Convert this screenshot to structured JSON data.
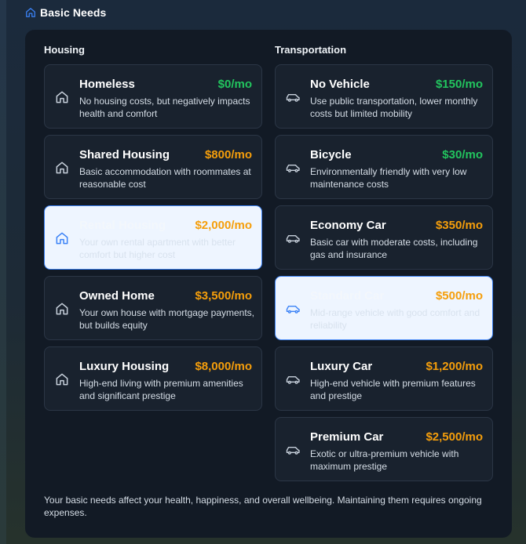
{
  "header": {
    "title": "Basic Needs",
    "icon": "home-icon"
  },
  "housing": {
    "heading": "Housing",
    "options": [
      {
        "title": "Homeless",
        "price": "$0/mo",
        "description": "No housing costs, but negatively impacts health and comfort",
        "price_color": "green",
        "selected": false,
        "icon": "home-icon"
      },
      {
        "title": "Shared Housing",
        "price": "$800/mo",
        "description": "Basic accommodation with roommates at reasonable cost",
        "price_color": "orange",
        "selected": false,
        "icon": "home-icon"
      },
      {
        "title": "Rental Housing",
        "price": "$2,000/mo",
        "description": "Your own rental apartment with better comfort but higher cost",
        "price_color": "orange",
        "selected": true,
        "icon": "home-icon"
      },
      {
        "title": "Owned Home",
        "price": "$3,500/mo",
        "description": "Your own house with mortgage payments, but builds equity",
        "price_color": "orange",
        "selected": false,
        "icon": "home-icon"
      },
      {
        "title": "Luxury Housing",
        "price": "$8,000/mo",
        "description": "High-end living with premium amenities and significant prestige",
        "price_color": "orange",
        "selected": false,
        "icon": "home-icon"
      }
    ]
  },
  "transportation": {
    "heading": "Transportation",
    "options": [
      {
        "title": "No Vehicle",
        "price": "$150/mo",
        "description": "Use public transportation, lower monthly costs but limited mobility",
        "price_color": "green",
        "selected": false,
        "icon": "car-icon"
      },
      {
        "title": "Bicycle",
        "price": "$30/mo",
        "description": "Environmentally friendly with very low maintenance costs",
        "price_color": "green",
        "selected": false,
        "icon": "car-icon"
      },
      {
        "title": "Economy Car",
        "price": "$350/mo",
        "description": "Basic car with moderate costs, including gas and insurance",
        "price_color": "orange",
        "selected": false,
        "icon": "car-icon"
      },
      {
        "title": "Standard Car",
        "price": "$500/mo",
        "description": "Mid-range vehicle with good comfort and reliability",
        "price_color": "orange",
        "selected": true,
        "icon": "car-icon"
      },
      {
        "title": "Luxury Car",
        "price": "$1,200/mo",
        "description": "High-end vehicle with premium features and prestige",
        "price_color": "orange",
        "selected": false,
        "icon": "car-icon"
      },
      {
        "title": "Premium Car",
        "price": "$2,500/mo",
        "description": "Exotic or ultra-premium vehicle with maximum prestige",
        "price_color": "orange",
        "selected": false,
        "icon": "car-icon"
      }
    ]
  },
  "footer": {
    "note": "Your basic needs affect your health, happiness, and overall wellbeing. Maintaining them requires ongoing expenses."
  },
  "colors": {
    "accent": "#3b82f6",
    "price_green": "#22c55e",
    "price_orange": "#f59e0b",
    "panel": "#121a25",
    "card": "#19222e",
    "selected_card": "#eef5ff"
  }
}
